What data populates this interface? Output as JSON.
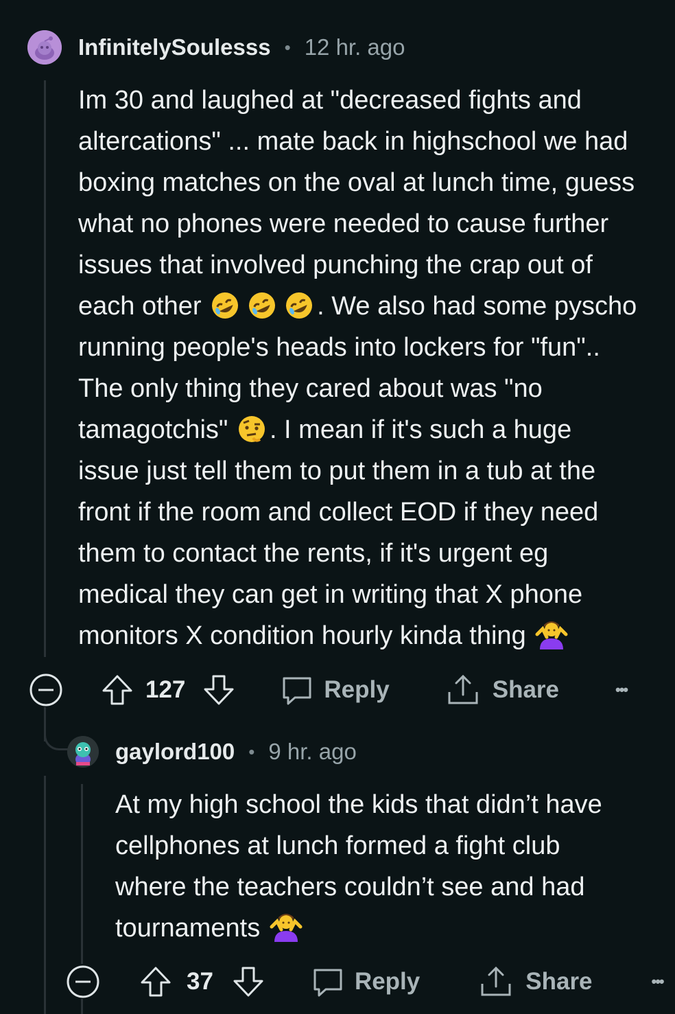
{
  "comment": {
    "username": "InfinitelySoulesss",
    "separator": "•",
    "time": "12 hr. ago",
    "lines": [
      "Im 30 and laughed at \"decreased fights and",
      "altercations\" ... mate back in highschool we had",
      "boxing matches on the oval at lunch time, guess",
      "what no phones were needed to cause further",
      "issues that involved punching the crap out of"
    ],
    "line6_before": "each other",
    "line6_after": ". We also had some pyscho",
    "line7": "running people's heads into lockers for \"fun\"..",
    "line8": "The only thing they cared about was \"no",
    "line9_before": "tamagotchis\"",
    "line9_after": ". I mean if it's such a huge",
    "lines_rest": [
      "issue just tell them to put them in a tub at the",
      "front if the room and collect EOD if they need",
      "them to contact the rents, if it's urgent eg",
      "medical they can get in writing that X phone"
    ],
    "line14_before": "monitors X condition hourly kinda thing",
    "votes": "127",
    "reply_label": "Reply",
    "share_label": "Share",
    "more_label": "•••"
  },
  "reply": {
    "username": "gaylord100",
    "separator": "•",
    "time": "9 hr. ago",
    "lines": [
      "At my high school the kids that didn’t have",
      "cellphones at lunch formed a fight club",
      "where the teachers couldn’t see and had"
    ],
    "last_before": "tournaments",
    "votes": "37",
    "reply_label": "Reply",
    "share_label": "Share",
    "more_label": "•••"
  },
  "icons": {
    "avatar1": "snoo-avatar-icon",
    "avatar2": "snoo-avatar-icon",
    "emoji_laugh": "rolling-on-floor-laughing-emoji",
    "emoji_raised_eyebrow": "raised-eyebrow-emoji",
    "emoji_shrug": "person-shrugging-emoji",
    "collapse": "collapse-minus-icon",
    "upvote": "upvote-arrow-icon",
    "downvote": "downvote-arrow-icon",
    "reply": "speech-bubble-icon",
    "share": "share-upload-icon"
  },
  "colors": {
    "background": "#0b1416",
    "text": "#eef1f2",
    "meta": "#97a4a9",
    "thread_line": "#2a3236",
    "avatar1_bg": "#b88fd8",
    "avatar2_bg": "#2b3436"
  }
}
